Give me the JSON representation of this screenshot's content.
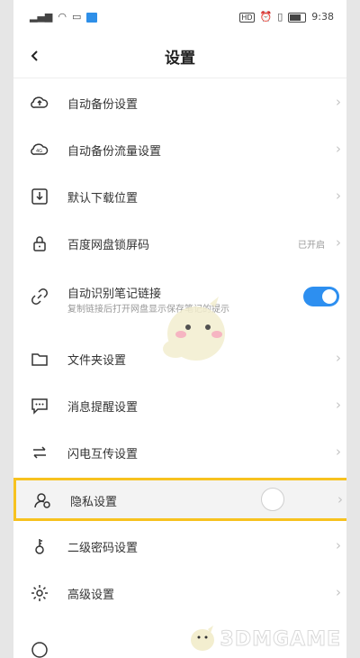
{
  "status_bar": {
    "time": "9:38",
    "hd_badge": "HD"
  },
  "header": {
    "back_symbol": "<",
    "title": "设置"
  },
  "rows": [
    {
      "label": "自动备份设置",
      "icon": "cloud-upload-icon"
    },
    {
      "label": "自动备份流量设置",
      "icon": "cloud-data-icon"
    },
    {
      "label": "默认下载位置",
      "icon": "download-icon"
    },
    {
      "label": "百度网盘锁屏码",
      "icon": "lock-icon",
      "status": "已开启"
    },
    {
      "label": "自动识别笔记链接",
      "icon": "link-icon",
      "subtitle": "复制链接后打开网盘显示保存笔记的提示",
      "toggle_on": true
    },
    {
      "label": "文件夹设置",
      "icon": "folder-icon"
    },
    {
      "label": "消息提醒设置",
      "icon": "message-icon"
    },
    {
      "label": "闪电互传设置",
      "icon": "transfer-icon"
    },
    {
      "label": "隐私设置",
      "icon": "privacy-icon",
      "highlighted": true
    },
    {
      "label": "二级密码设置",
      "icon": "key-icon"
    },
    {
      "label": "高级设置",
      "icon": "gear-icon"
    }
  ],
  "chevron": "›",
  "watermark": {
    "text": "3DMGAME"
  },
  "colors": {
    "accent": "#2d8ff0",
    "highlight": "#f7c21f"
  }
}
